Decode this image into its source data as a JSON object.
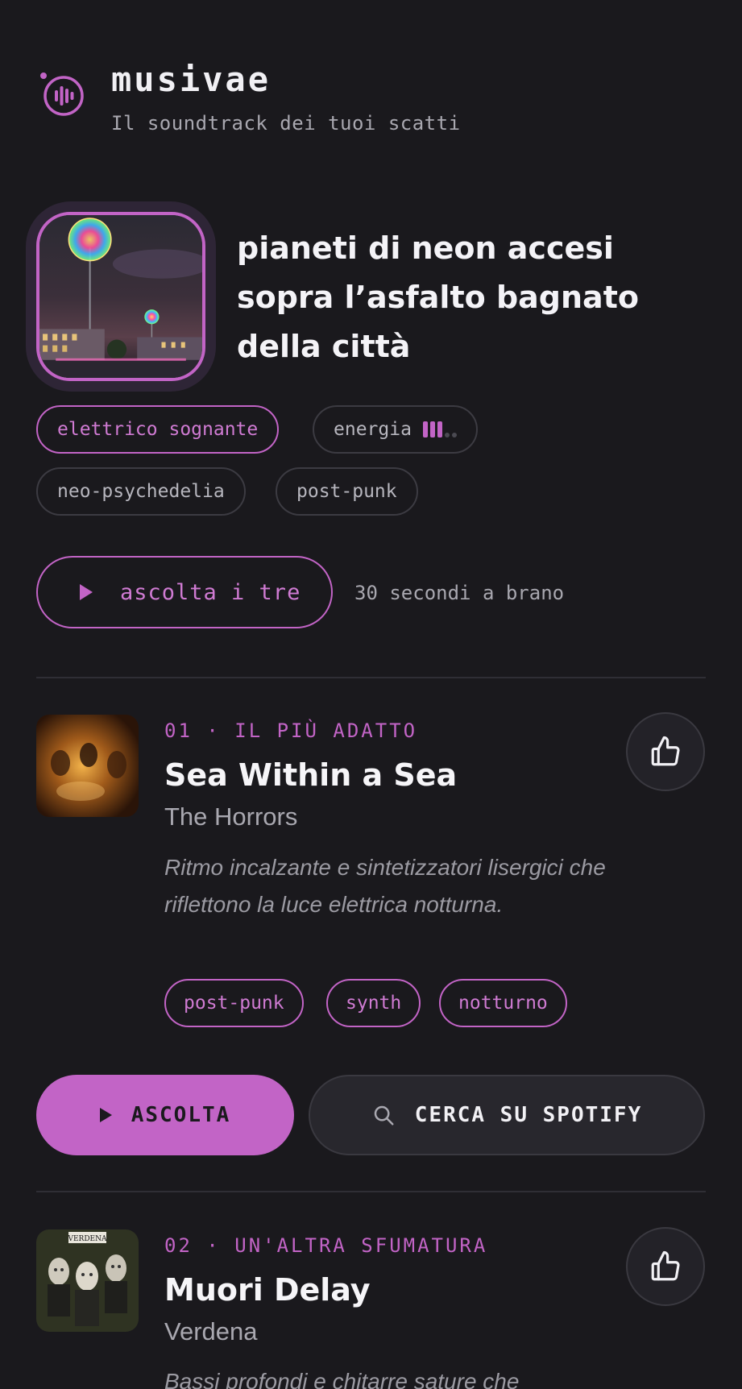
{
  "app": {
    "name": "musivae",
    "tagline": "Il soundtrack dei tuoi scatti"
  },
  "photo": {
    "caption": "pianeti di neon accesi sopra l’asfalto bagnato della città"
  },
  "mood_chips": {
    "mood": "elettrico sognante",
    "energy_label": "energia",
    "energy_level": 3,
    "energy_max": 5,
    "genres": [
      "neo-psychedelia",
      "post-punk"
    ]
  },
  "player": {
    "play_all_label": "ascolta i tre",
    "duration_note": "30 secondi a brano"
  },
  "tracks": [
    {
      "label": "01 · IL PIÙ ADATTO",
      "title": "Sea Within a Sea",
      "artist": "The Horrors",
      "description": "Ritmo incalzante e sintetizzatori lisergici che riflettono la luce elettrica notturna.",
      "tags": [
        "post-punk",
        "synth",
        "notturno"
      ]
    },
    {
      "label": "02 · UN'ALTRA SFUMATURA",
      "title": "Muori Delay",
      "artist": "Verdena",
      "description": "Bassi profondi e chitarre sature che",
      "cover_text": "VERDENA"
    }
  ],
  "actions": {
    "listen_label": "ASCOLTA",
    "spotify_label": "CERCA SU SPOTIFY"
  },
  "colors": {
    "background": "#1a191d",
    "accent": "#c264c6",
    "muted": "#a9a8b0"
  }
}
